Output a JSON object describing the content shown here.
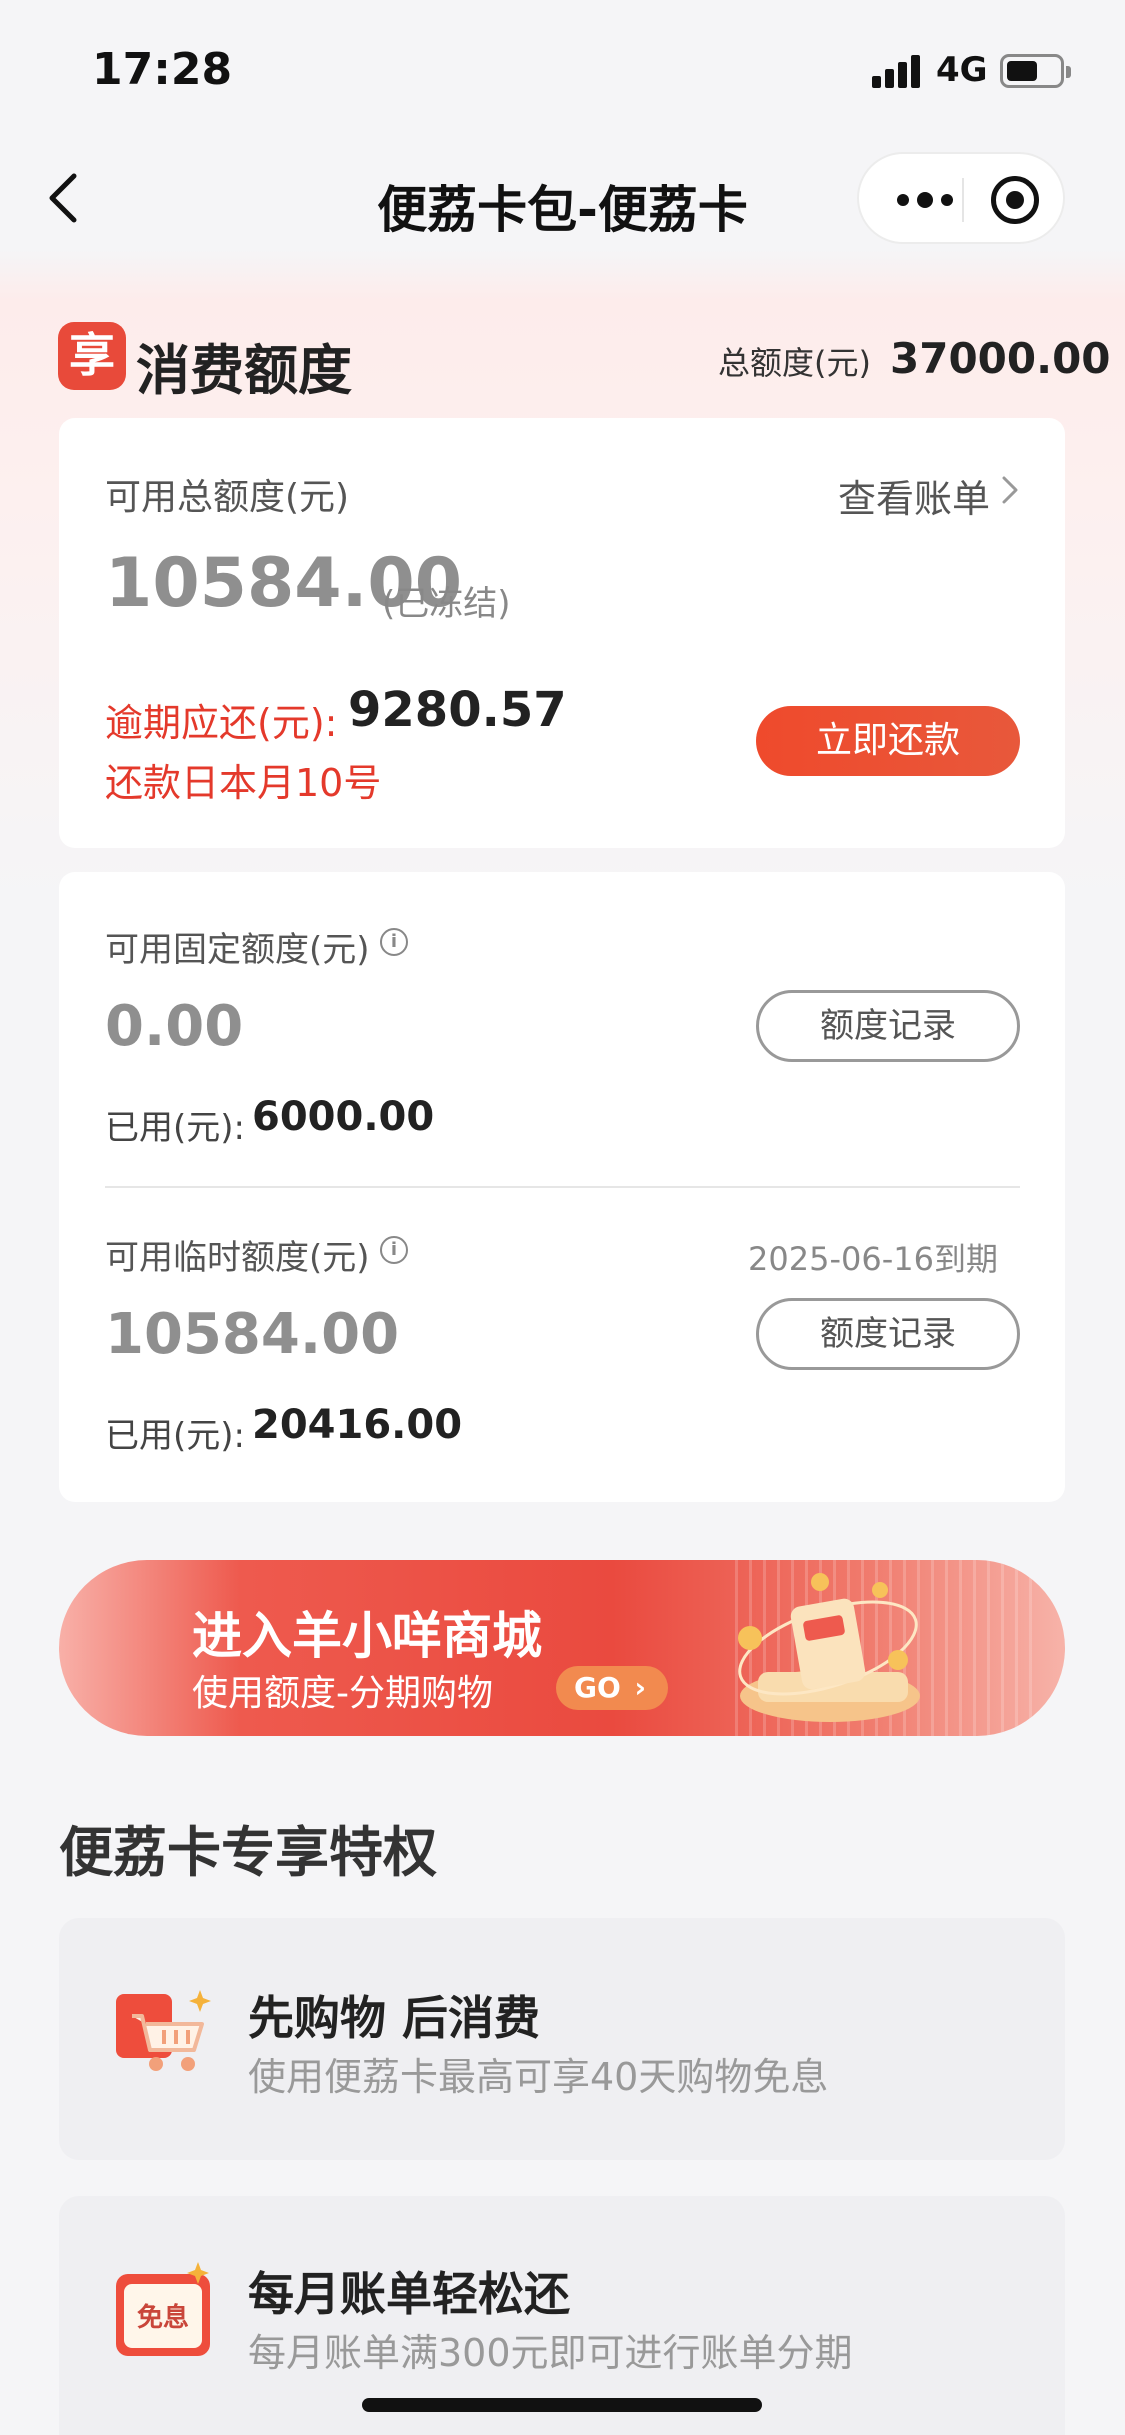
{
  "status_bar": {
    "time": "17:28",
    "network": "4G"
  },
  "nav": {
    "title": "便荔卡包-便荔卡"
  },
  "header": {
    "badge_char": "享",
    "section_title": "消费额度",
    "total_label": "总额度(元)",
    "total_value": "37000.00"
  },
  "available_card": {
    "label": "可用总额度(元)",
    "view_bill": "查看账单",
    "amount": "10584.00",
    "frozen_note": "(已冻结)",
    "overdue_label": "逾期应还(元):",
    "overdue_value": "9280.57",
    "repay_day": "还款日本月10号",
    "repay_button": "立即还款"
  },
  "fixed_limit": {
    "label": "可用固定额度(元)",
    "info_icon": "i",
    "amount": "0.00",
    "record_button": "额度记录",
    "used_label": "已用(元):",
    "used_value": "6000.00"
  },
  "temp_limit": {
    "label": "可用临时额度(元)",
    "info_icon": "i",
    "expiry": "2025-06-16到期",
    "amount": "10584.00",
    "record_button": "额度记录",
    "used_label": "已用(元):",
    "used_value": "20416.00"
  },
  "banner": {
    "title": "进入羊小咩商城",
    "subtitle": "使用额度-分期购物",
    "go_label": "GO"
  },
  "privileges": {
    "title": "便荔卡专享特权",
    "items": [
      {
        "icon": "shopping-cart-icon",
        "title": "先购物 后消费",
        "desc": "使用便荔卡最高可享40天购物免息"
      },
      {
        "icon": "interest-free-icon",
        "icon_text": "免息",
        "title": "每月账单轻松还",
        "desc": "每月账单满300元即可进行账单分期"
      }
    ]
  },
  "colors": {
    "accent_red": "#e4392b",
    "button_red": "#ef4a2c",
    "banner_red": "#ea4a3f"
  }
}
